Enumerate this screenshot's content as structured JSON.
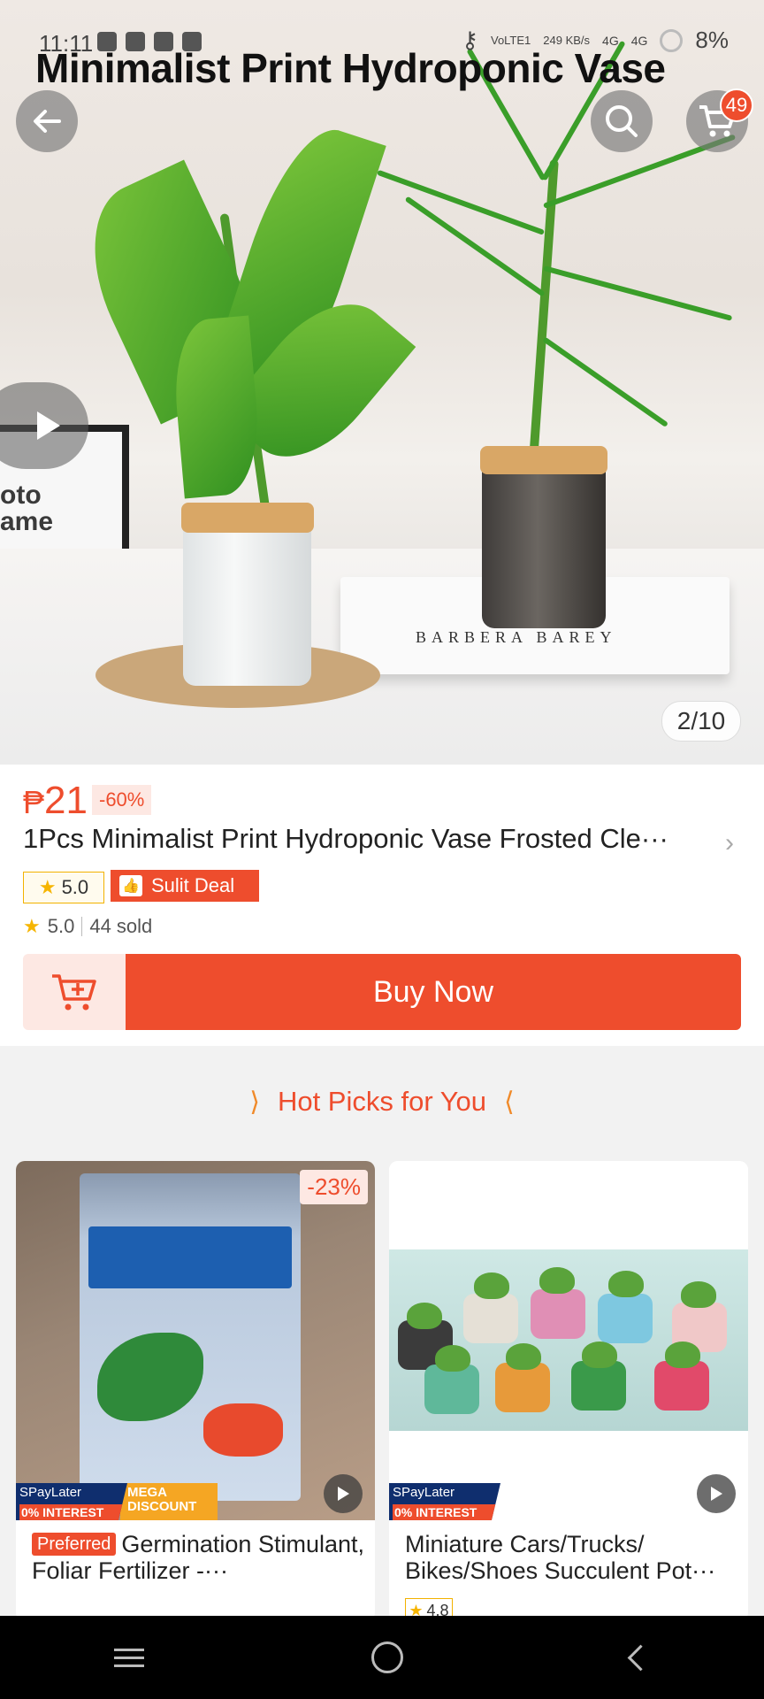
{
  "status_bar": {
    "time": "11:11",
    "network": "VoLTE1",
    "speed": "249 KB/s",
    "signal_1": "4G",
    "signal_2": "4G",
    "battery": "8%"
  },
  "hero": {
    "overlay_title": "Minimalist Print Hydroponic Vase",
    "book_text": "BARBERA BAREY",
    "frame_text_1": "oto",
    "frame_text_2": "ame",
    "image_counter": "2/10",
    "cart_count": "49"
  },
  "product": {
    "currency": "₱",
    "price": "21",
    "discount": "-60%",
    "title": "1Pcs Minimalist Print Hydroponic Vase Frosted Cle···",
    "rating_badge": "5.0",
    "deal_label": "Sulit Deal",
    "rating": "5.0",
    "sold": "44 sold",
    "buy_now_label": "Buy Now"
  },
  "hot_picks": {
    "header": "Hot Picks for You",
    "items": [
      {
        "discount": "-23%",
        "spay_label": "SPayLater",
        "interest_label": "0% INTEREST",
        "mega_label": "MEGA DISCOUNT",
        "preferred_label": "Preferred",
        "name": "Germination Stimulant, Foliar Fertilizer -···"
      },
      {
        "spay_label": "SPayLater",
        "interest_label": "0% INTEREST",
        "name": "Miniature Cars/Trucks/ Bikes/Shoes Succulent Pot···",
        "rating": "4.8"
      }
    ]
  },
  "icons": {
    "back": "arrow-left-icon",
    "search": "search-icon",
    "cart": "cart-icon",
    "play": "play-icon",
    "add_to_cart": "cart-plus-icon"
  },
  "colors": {
    "accent": "#ee4d2d",
    "star": "#f6b500"
  }
}
